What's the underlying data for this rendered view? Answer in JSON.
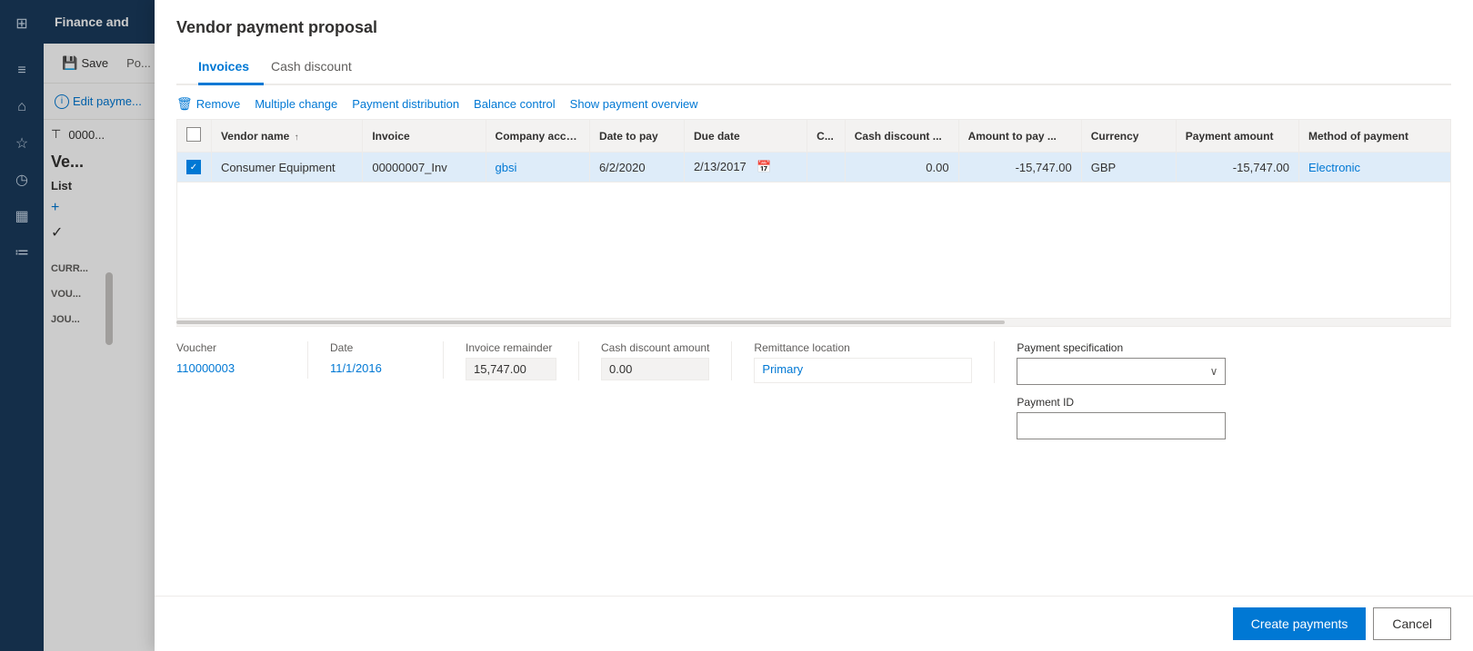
{
  "app": {
    "title": "Finance and",
    "icon": "⊞"
  },
  "sidebar": {
    "icons": [
      "≡",
      "⌂",
      "☆",
      "◷",
      "▦",
      "≔"
    ]
  },
  "topbar": {
    "save_label": "Save",
    "post_label": "Po..."
  },
  "edit_payment": {
    "label": "Edit payme..."
  },
  "left_panel": {
    "filter_section": "CURR...",
    "voucher_section": "VOU...",
    "journal_section": "JOU...",
    "list_label": "List",
    "add_label": "+",
    "check_label": "✓"
  },
  "page_title": "Ve...",
  "modal": {
    "title": "Vendor payment proposal",
    "tabs": [
      {
        "id": "invoices",
        "label": "Invoices",
        "active": true
      },
      {
        "id": "cash-discount",
        "label": "Cash discount",
        "active": false
      }
    ],
    "toolbar": {
      "remove_label": "Remove",
      "remove_icon": "🗑",
      "multiple_change_label": "Multiple change",
      "payment_distribution_label": "Payment distribution",
      "balance_control_label": "Balance control",
      "show_payment_overview_label": "Show payment overview"
    },
    "table": {
      "columns": [
        {
          "id": "check",
          "label": ""
        },
        {
          "id": "vendor-name",
          "label": "Vendor name",
          "sortable": true
        },
        {
          "id": "invoice",
          "label": "Invoice"
        },
        {
          "id": "company-acct",
          "label": "Company acco..."
        },
        {
          "id": "date-to-pay",
          "label": "Date to pay"
        },
        {
          "id": "due-date",
          "label": "Due date"
        },
        {
          "id": "c",
          "label": "C..."
        },
        {
          "id": "cash-discount",
          "label": "Cash discount ..."
        },
        {
          "id": "amount-to-pay",
          "label": "Amount to pay ..."
        },
        {
          "id": "currency",
          "label": "Currency"
        },
        {
          "id": "payment-amount",
          "label": "Payment amount"
        },
        {
          "id": "method-of-payment",
          "label": "Method of payment"
        }
      ],
      "rows": [
        {
          "selected": true,
          "vendor_name": "Consumer Equipment",
          "invoice": "00000007_Inv",
          "company_acct": "gbsi",
          "date_to_pay": "6/2/2020",
          "due_date": "2/13/2017",
          "c": "",
          "cash_discount": "0.00",
          "amount_to_pay": "-15,747.00",
          "currency": "GBP",
          "payment_amount": "-15,747.00",
          "method_of_payment": "Electronic"
        }
      ]
    },
    "details": {
      "voucher_label": "Voucher",
      "voucher_value": "110000003",
      "date_label": "Date",
      "date_value": "11/1/2016",
      "invoice_remainder_label": "Invoice remainder",
      "invoice_remainder_value": "15,747.00",
      "cash_discount_amount_label": "Cash discount amount",
      "cash_discount_amount_value": "0.00",
      "remittance_location_label": "Remittance location",
      "remittance_location_value": "Primary",
      "payment_specification_label": "Payment specification",
      "payment_specification_value": "",
      "payment_id_label": "Payment ID",
      "payment_id_value": ""
    },
    "footer": {
      "create_payments_label": "Create payments",
      "cancel_label": "Cancel"
    }
  }
}
